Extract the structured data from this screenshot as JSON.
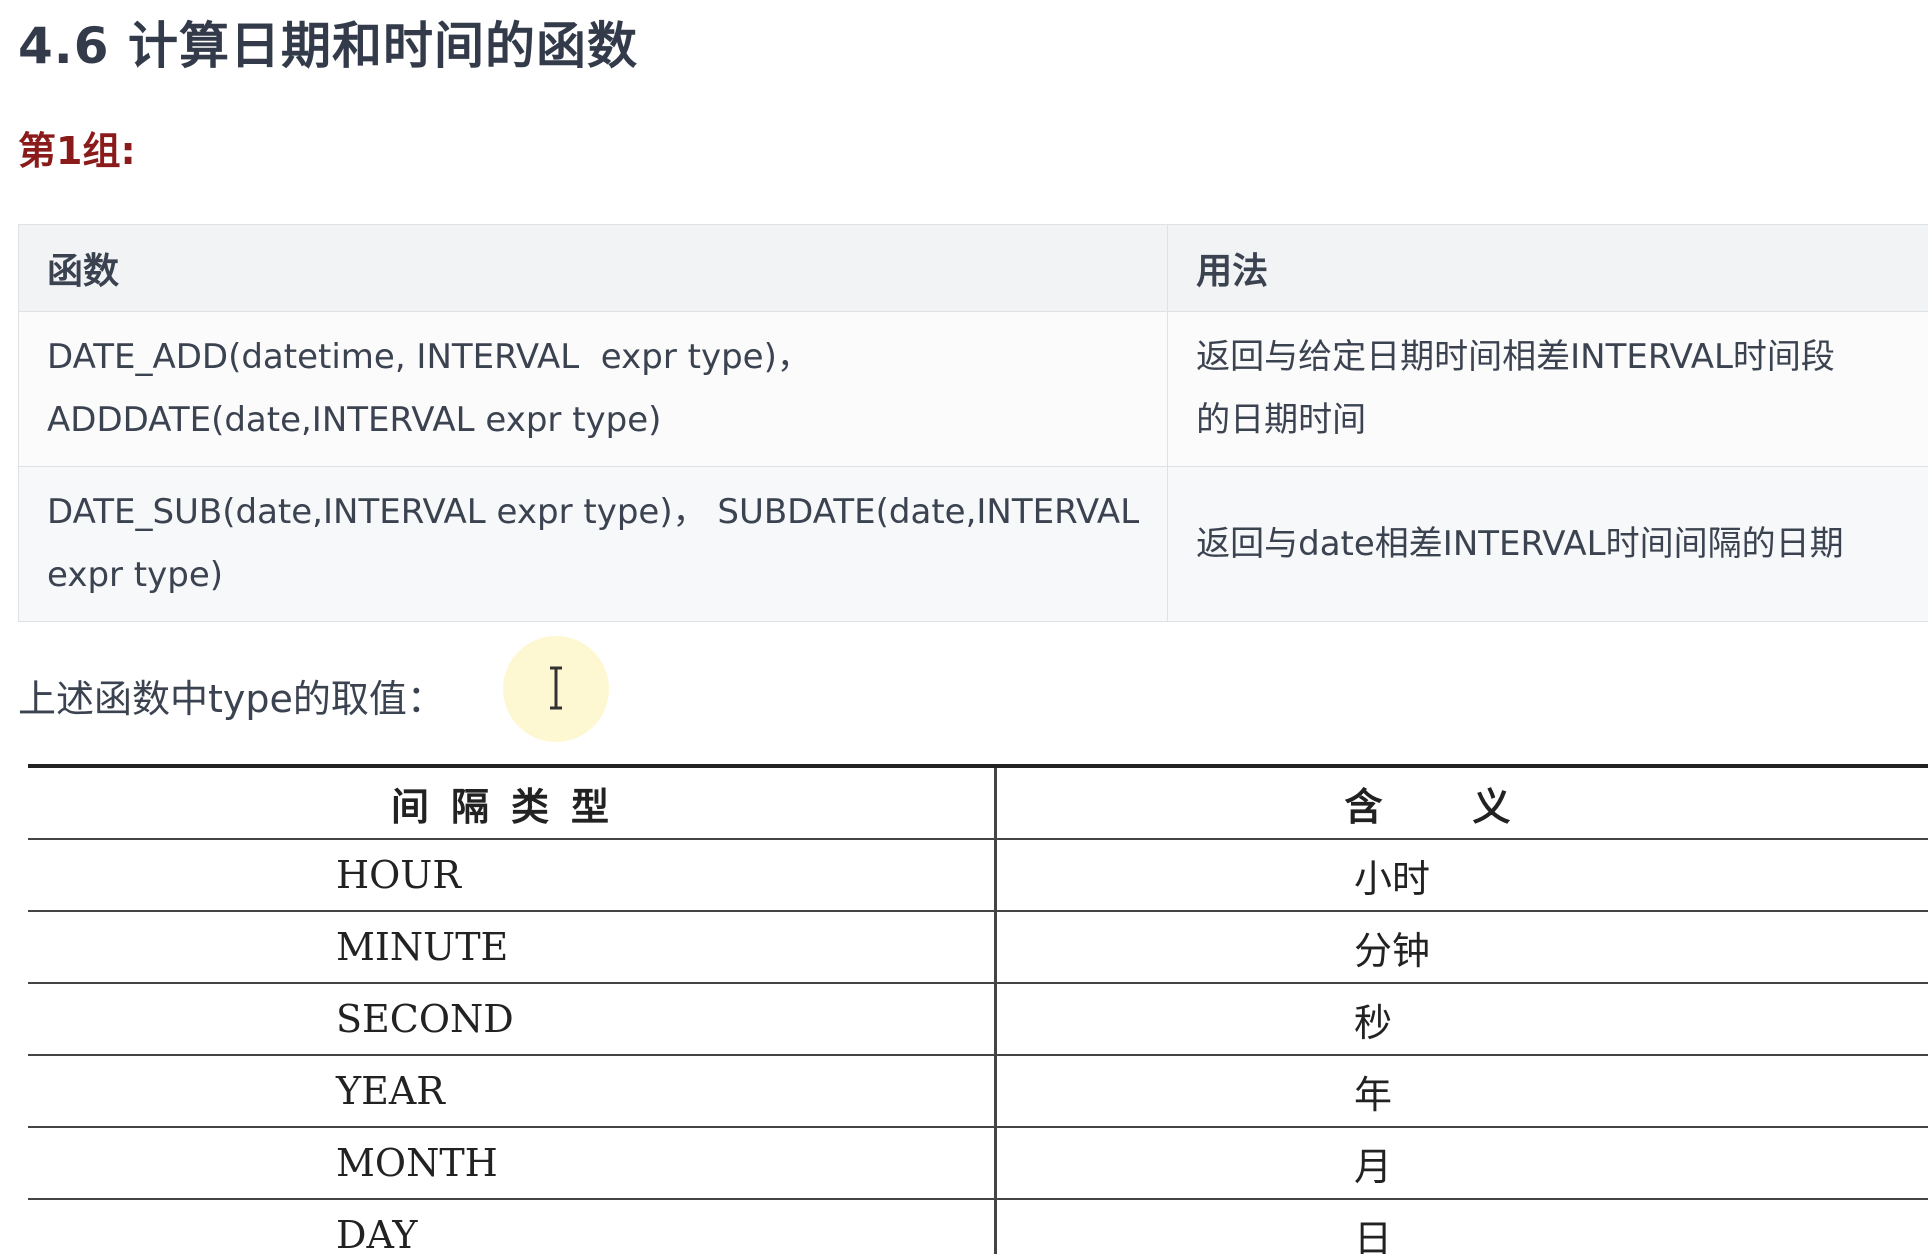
{
  "title": "4.6 计算日期和时间的函数",
  "group_label": "第1组:",
  "func_table": {
    "headers": [
      "函数",
      "用法"
    ],
    "rows": [
      {
        "function_lines": [
          "DATE_ADD(datetime, INTERVAL  expr type)，",
          "ADDDATE(date,INTERVAL expr type)"
        ],
        "usage_lines": [
          "返回与给定日期时间相差INTERVAL时间段",
          "的日期时间"
        ]
      },
      {
        "function_lines": [
          "DATE_SUB(date,INTERVAL expr type)， SUBDATE(date,INTERVAL",
          "expr type)"
        ],
        "usage_lines": [
          "返回与date相差INTERVAL时间间隔的日期"
        ]
      }
    ]
  },
  "note": "上述函数中type的取值：",
  "cursor": {
    "icon": "text-cursor-icon",
    "highlight_color": "#fdf8d2"
  },
  "type_table": {
    "headers": [
      "间隔类型",
      "含义"
    ],
    "rows": [
      {
        "type": "HOUR",
        "meaning": "小时"
      },
      {
        "type": "MINUTE",
        "meaning": "分钟"
      },
      {
        "type": "SECOND",
        "meaning": "秒"
      },
      {
        "type": "YEAR",
        "meaning": "年"
      },
      {
        "type": "MONTH",
        "meaning": "月"
      },
      {
        "type": "DAY",
        "meaning": "日"
      }
    ]
  },
  "colors": {
    "title": "#333b4a",
    "group_label": "#8b1a1a",
    "table_header_bg": "#f2f3f5",
    "table_border": "#dfe2e5"
  }
}
